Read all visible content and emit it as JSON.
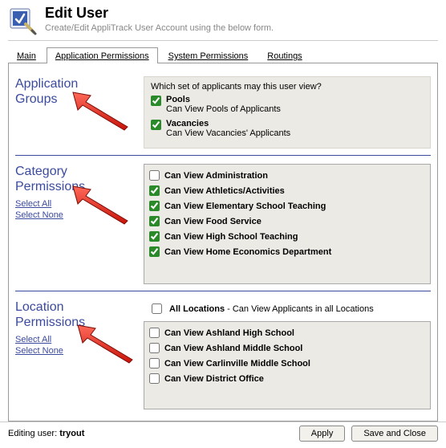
{
  "header": {
    "title": "Edit User",
    "subtitle": "Create/Edit AppliTrack User Account using the below form."
  },
  "tabs": {
    "main": "Main",
    "app_perm": "Application Permissions",
    "sys_perm": "System Permissions",
    "routings": "Routings"
  },
  "sections": {
    "app_groups": {
      "title_line1": "Application",
      "title_line2": "Groups",
      "prompt": "Which set of applicants may this user view?",
      "opts": [
        {
          "label": "Pools",
          "sub": "Can View Pools of Applicants",
          "checked": true
        },
        {
          "label": "Vacancies",
          "sub": "Can View Vacancies' Applicants",
          "checked": true
        }
      ]
    },
    "category": {
      "title_line1": "Category",
      "title_line2": "Permissions",
      "select_all": "Select All",
      "select_none": "Select None",
      "items": [
        {
          "label": "Can View Administration",
          "checked": false
        },
        {
          "label": "Can View Athletics/Activities",
          "checked": true
        },
        {
          "label": "Can View Elementary School Teaching",
          "checked": true
        },
        {
          "label": "Can View Food Service",
          "checked": true
        },
        {
          "label": "Can View High School Teaching",
          "checked": true
        },
        {
          "label": "Can View Home Economics Department",
          "checked": true
        }
      ]
    },
    "location": {
      "title_line1": "Location",
      "title_line2": "Permissions",
      "select_all": "Select All",
      "select_none": "Select None",
      "all_label": "All Locations",
      "all_desc": " - Can View Applicants in all Locations",
      "items": [
        {
          "label": "Can View Ashland High School",
          "checked": false
        },
        {
          "label": "Can View Ashland Middle School",
          "checked": false
        },
        {
          "label": "Can View Carlinville Middle School",
          "checked": false
        },
        {
          "label": "Can View District Office",
          "checked": false
        }
      ]
    }
  },
  "footer": {
    "editing_label": "Editing user: ",
    "editing_user": "tryout",
    "apply": "Apply",
    "save_close": "Save and Close"
  }
}
